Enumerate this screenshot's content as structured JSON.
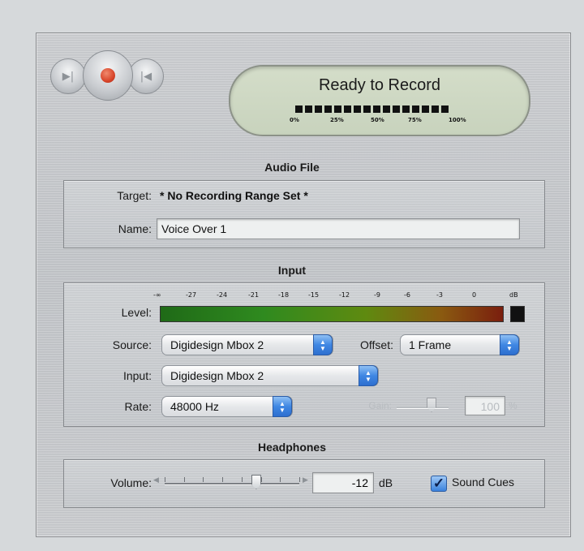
{
  "transport": {
    "prev_icon": "skip-back-icon",
    "record_icon": "record-dot-icon",
    "next_icon": "skip-forward-icon",
    "prev_glyph": "▶|",
    "next_glyph": "|◀"
  },
  "status": {
    "title": "Ready to Record",
    "meter_ticks": [
      "0%",
      "25%",
      "50%",
      "75%",
      "100%"
    ],
    "segments": 16
  },
  "audio_file": {
    "section_title": "Audio File",
    "target_label": "Target:",
    "target_value": "* No Recording Range Set *",
    "name_label": "Name:",
    "name_value": "Voice Over 1"
  },
  "input": {
    "section_title": "Input",
    "level_label": "Level:",
    "scale": [
      "-∞",
      "-27",
      "-24",
      "-21",
      "-18",
      "-15",
      "-12",
      "-9",
      "-6",
      "-3",
      "0",
      "dB"
    ],
    "source_label": "Source:",
    "source_value": "Digidesign Mbox 2",
    "offset_label": "Offset:",
    "offset_value": "1 Frame",
    "input_label": "Input:",
    "input_value": "Digidesign Mbox 2",
    "rate_label": "Rate:",
    "rate_value": "48000 Hz",
    "gain_label": "Gain:",
    "gain_value": "100",
    "gain_unit": "%"
  },
  "headphones": {
    "section_title": "Headphones",
    "volume_label": "Volume:",
    "volume_value": "-12",
    "volume_unit": "dB",
    "volume_level": 0.68,
    "sound_cues_label": "Sound Cues",
    "sound_cues_checked": true
  },
  "colors": {
    "lcd_bg": "#cbd5c0",
    "record_red": "#d8452a",
    "accent_blue": "#3b82dd"
  }
}
